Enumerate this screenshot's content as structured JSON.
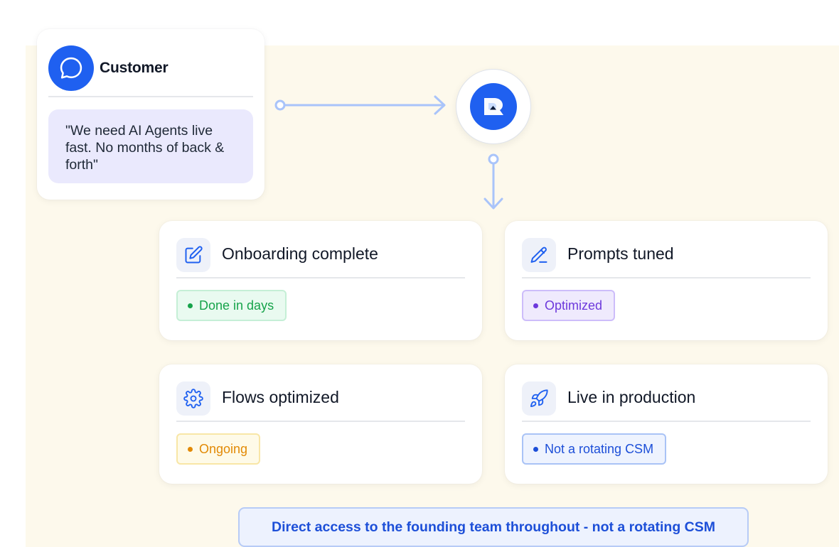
{
  "customer": {
    "name": "Customer",
    "quote": "\"We need AI Agents live fast. No months of back & forth\"",
    "icon": "chat-bubble-icon"
  },
  "hub": {
    "icon": "brand-logo-icon"
  },
  "steps": [
    {
      "title": "Onboarding complete",
      "badge": "Done in days",
      "icon": "edit-square-icon",
      "tone": "green"
    },
    {
      "title": "Prompts tuned",
      "badge": "Optimized",
      "icon": "pencil-icon",
      "tone": "purple"
    },
    {
      "title": "Flows optimized",
      "badge": "Ongoing",
      "icon": "gear-icon",
      "tone": "amber"
    },
    {
      "title": "Live in production",
      "badge": "Not a rotating CSM",
      "icon": "rocket-icon",
      "tone": "blue"
    }
  ],
  "footer": {
    "note": "Direct access to the founding team throughout - not a rotating CSM"
  },
  "colors": {
    "brand_blue": "#1f60f0",
    "connector": "#a9c4fa",
    "background_tint": "#fdf9ec",
    "green": "#16a34a",
    "purple": "#6d39dc",
    "amber": "#e28a06",
    "blue": "#1d4fd8"
  }
}
